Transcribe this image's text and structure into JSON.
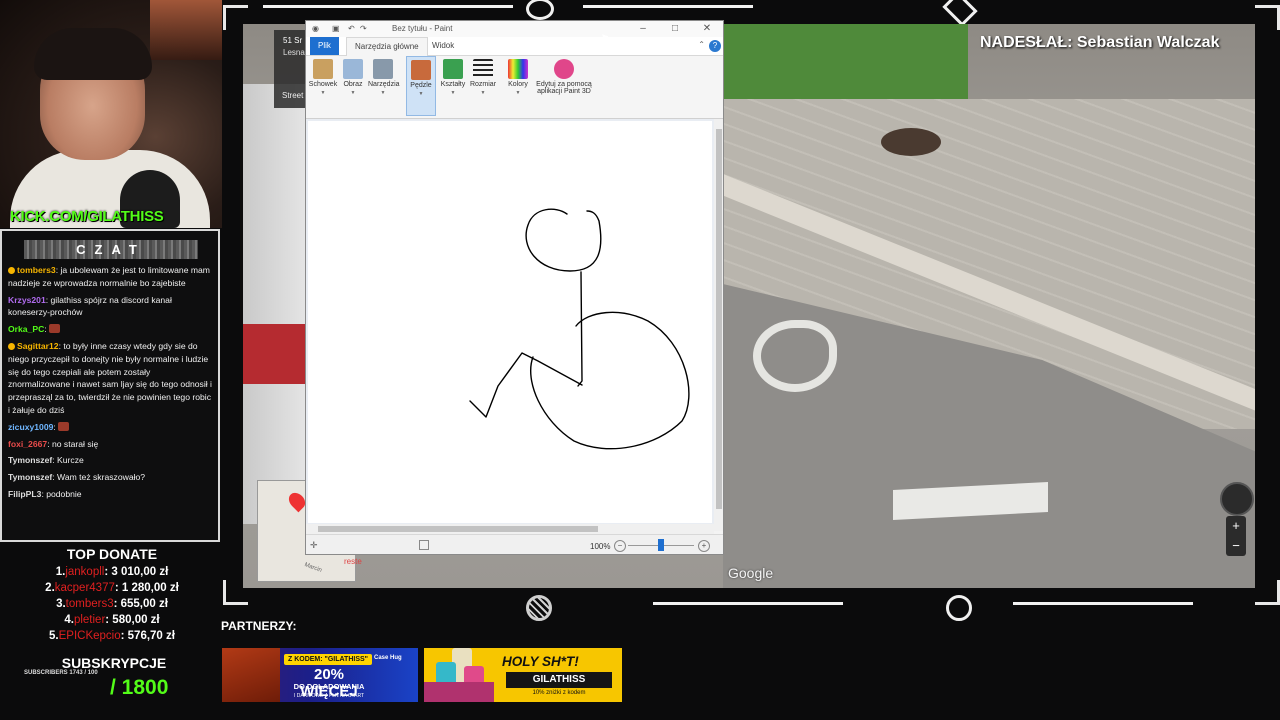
{
  "stream": {
    "kick_url": "KICK.COM/GILATHISS",
    "chat_title": "CZAT",
    "chat": [
      {
        "user": "tombers3",
        "user_color": "#f7b500",
        "badge": true,
        "text": "ja ubolewam że jest to limitowane mam nadzieje ze wprowadza normalnie bo zajebiste"
      },
      {
        "user": "Krzys201",
        "user_color": "#b16cf0",
        "badge": false,
        "text": "gilathiss spójrz na discord kanał koneserzy-prochów"
      },
      {
        "user": "Orka_PC",
        "user_color": "#53fc18",
        "badge": false,
        "text": ""
      },
      {
        "user": "Sagittar12",
        "user_color": "#f7b500",
        "badge": true,
        "text": "to były inne czasy wtedy gdy sie do niego przyczepił to donejty nie były normalne i ludzie się do tego czepiali ale potem zostały znormalizowane i nawet sam ljay się do tego odnosił i przeprasząl za to, twierdził że nie powinien tego robic i żałuje do dziś"
      },
      {
        "user": "zicuxy1009",
        "user_color": "#6fb6ff",
        "badge": false,
        "text": ""
      },
      {
        "user": "foxi_2667",
        "user_color": "#e84b4b",
        "badge": false,
        "text": "no starał się"
      },
      {
        "user": "Tymonszef",
        "user_color": "#dddddd",
        "badge": false,
        "text": "Kurcze"
      },
      {
        "user": "Tymonszef",
        "user_color": "#dddddd",
        "badge": false,
        "text": "Wam też skraszowało?"
      },
      {
        "user": "FilipPL3",
        "user_color": "#dddddd",
        "badge": false,
        "text": "podobnie"
      }
    ],
    "top_donate_title": "TOP DONATE",
    "donates": [
      {
        "rank": "1.",
        "name": "jankopll",
        "amount": ": 3 010,00 zł"
      },
      {
        "rank": "2.",
        "name": "kacper4377",
        "amount": ": 1 280,00 zł"
      },
      {
        "rank": "3.",
        "name": "tombers3",
        "amount": ": 655,00 zł"
      },
      {
        "rank": "4.",
        "name": "pletier",
        "amount": ": 580,00 zł"
      },
      {
        "rank": "5.",
        "name": "EPICKepcio",
        "amount": ": 576,70 zł"
      }
    ],
    "subs_title": "SUBSKRYPCJE",
    "subs_small": "SUBSCRIBERS 1743 / 100",
    "subs_goal": "/ 1800",
    "sender": "NADESŁAŁ: Sebastian Walczak",
    "partners_label": "PARTNERZY:"
  },
  "banners": {
    "case": {
      "code": "Z KODEM: \"GILATHISS\"",
      "brand": "Case Hug",
      "pct": "20% WIĘCEJ",
      "line2": "DO DOŁADOWANIA",
      "line3": "I DARMOWE 4 PLN NA START"
    },
    "holy": {
      "title": "HOLY SH*T!",
      "code": "GILATHISS",
      "sub": "10% zniżki z kodem"
    }
  },
  "streetview": {
    "place_line1": "51 Sr",
    "place_line2": "Lesna",
    "street_label": "Street",
    "google": "Google",
    "minimap_label": "reste",
    "minimap_street": "Marcin"
  },
  "paint": {
    "title": "Bez tytułu - Paint",
    "tabs": {
      "file": "Plik",
      "home": "Narzędzia główne",
      "view": "Widok"
    },
    "ribbon": [
      {
        "label": "Schowek",
        "icon": "clipboard-icon",
        "color": "#c9a060"
      },
      {
        "label": "Obraz",
        "icon": "image-select-icon",
        "color": "#9ab7d8"
      },
      {
        "label": "Narzędzia",
        "icon": "pencil-tools-icon",
        "color": "#8899aa"
      },
      {
        "label": "Pędzle",
        "icon": "brush-icon",
        "color": "#c86a3c"
      },
      {
        "label": "Kształty",
        "icon": "shapes-icon",
        "color": "#3aa050"
      },
      {
        "label": "Rozmiar",
        "icon": "line-size-icon",
        "color": "#222222"
      },
      {
        "label": "Kolory",
        "icon": "colors-icon",
        "color": "#b04ad0"
      },
      {
        "label": "Edytuj za pomocą aplikacji Paint 3D",
        "icon": "paint3d-icon",
        "color": "#e0468a"
      }
    ],
    "zoom": "100%"
  }
}
